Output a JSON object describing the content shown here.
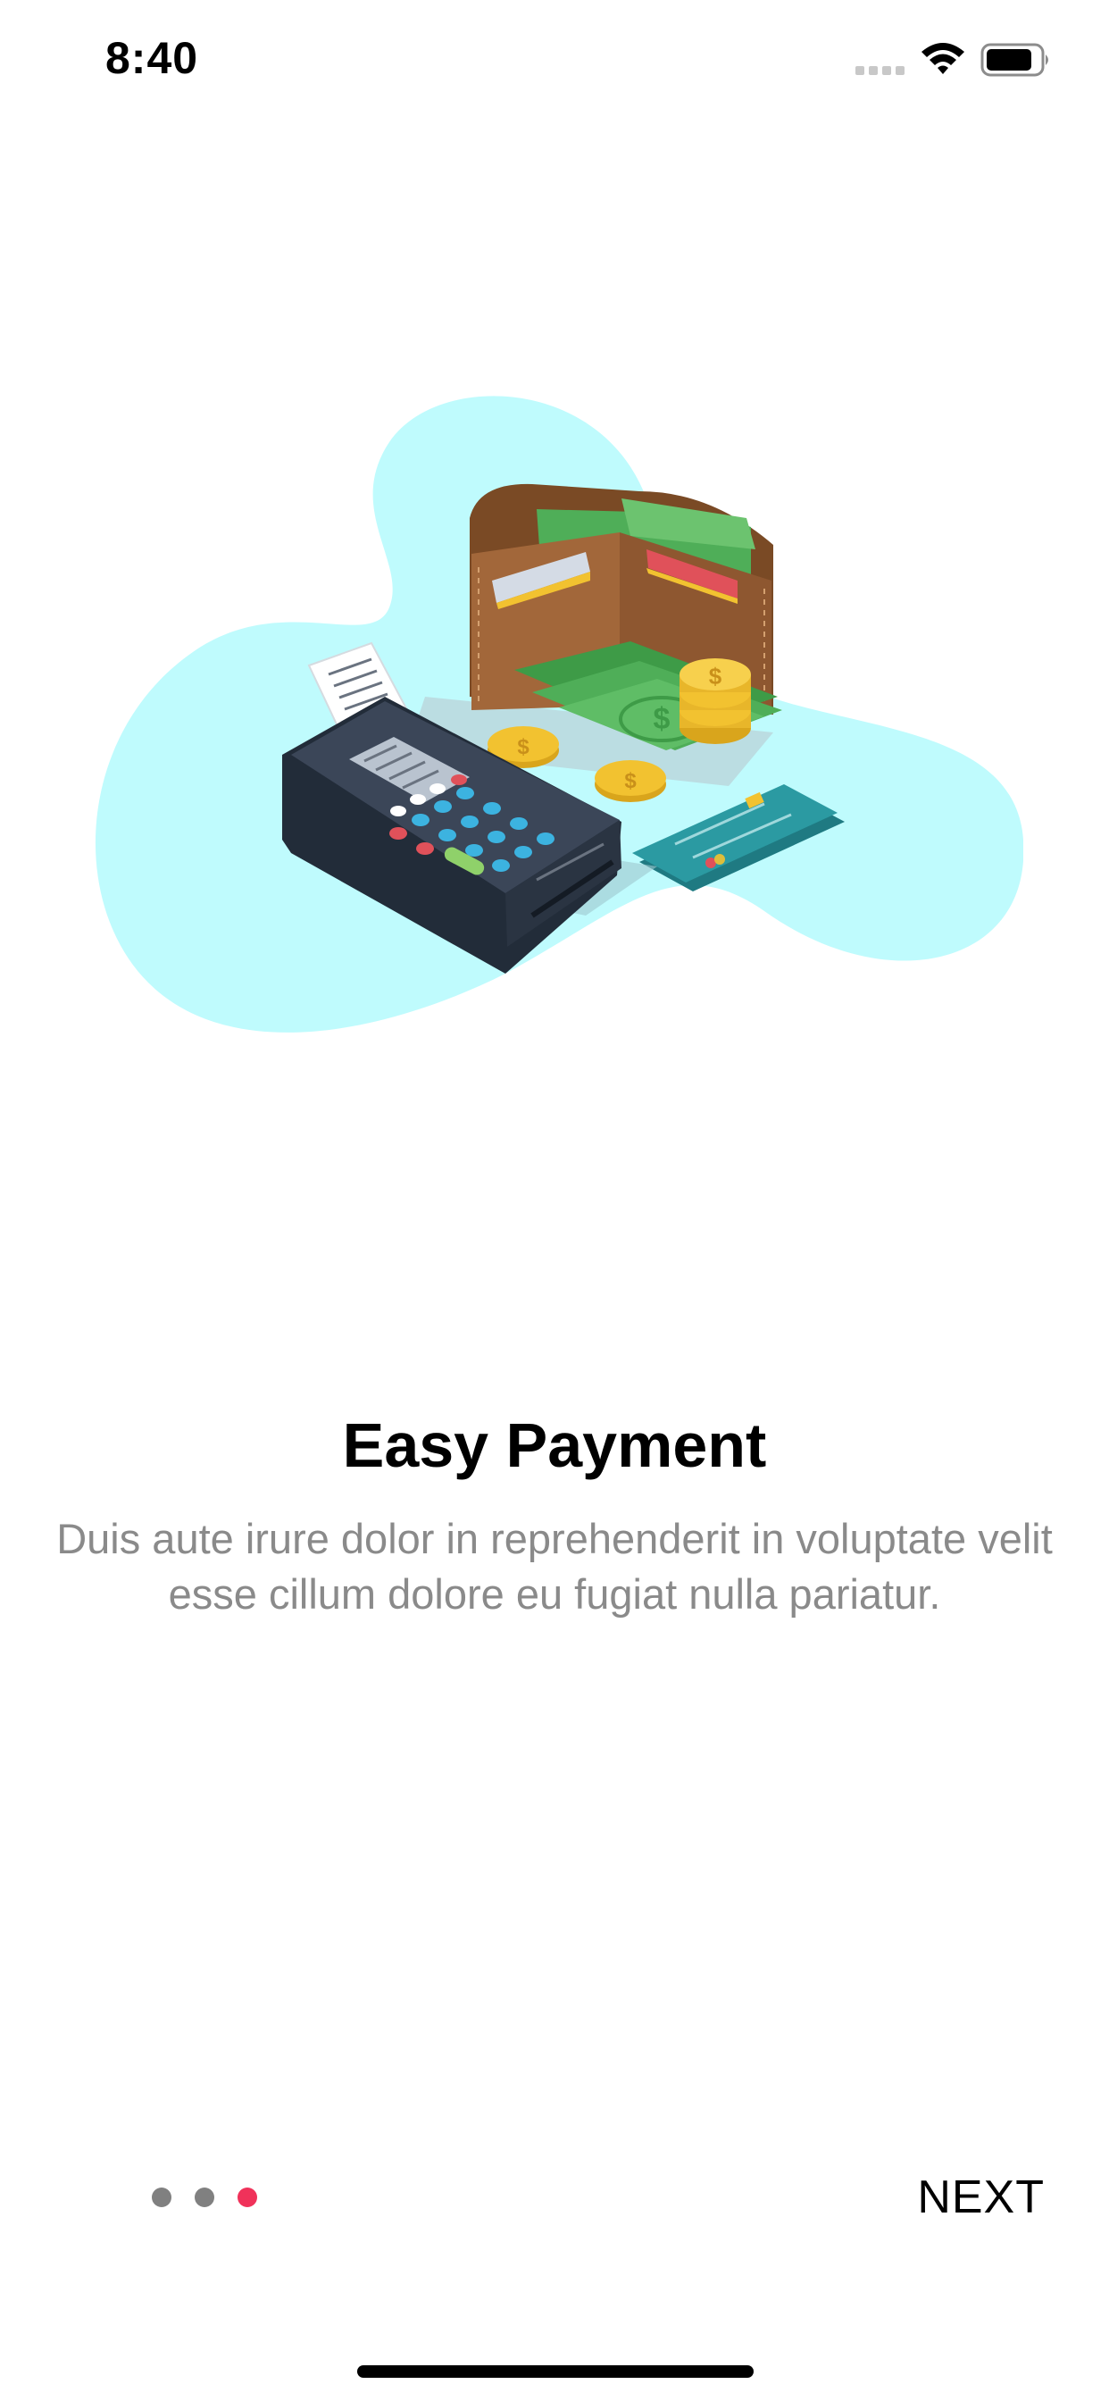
{
  "status_bar": {
    "time": "8:40",
    "icons": [
      "signal-icon",
      "wifi-icon",
      "battery-icon"
    ]
  },
  "illustration": {
    "subject": "payment-terminal-wallet-cash-card-icon",
    "colors": {
      "blob": "#bffbfd",
      "terminal": "#2d3848",
      "wallet": "#9b6234",
      "cash": "#5fb25f",
      "coin": "#f2c230",
      "card": "#2b9aa2"
    }
  },
  "onboarding": {
    "title": "Easy Payment",
    "description": "Duis aute irure dolor in reprehenderit in voluptate velit esse cillum dolore eu fugiat nulla pariatur."
  },
  "pager": {
    "total_pages": 3,
    "current_page": 3,
    "active_color": "#f0325a",
    "inactive_color": "#808080"
  },
  "actions": {
    "next_label": "NEXT"
  }
}
